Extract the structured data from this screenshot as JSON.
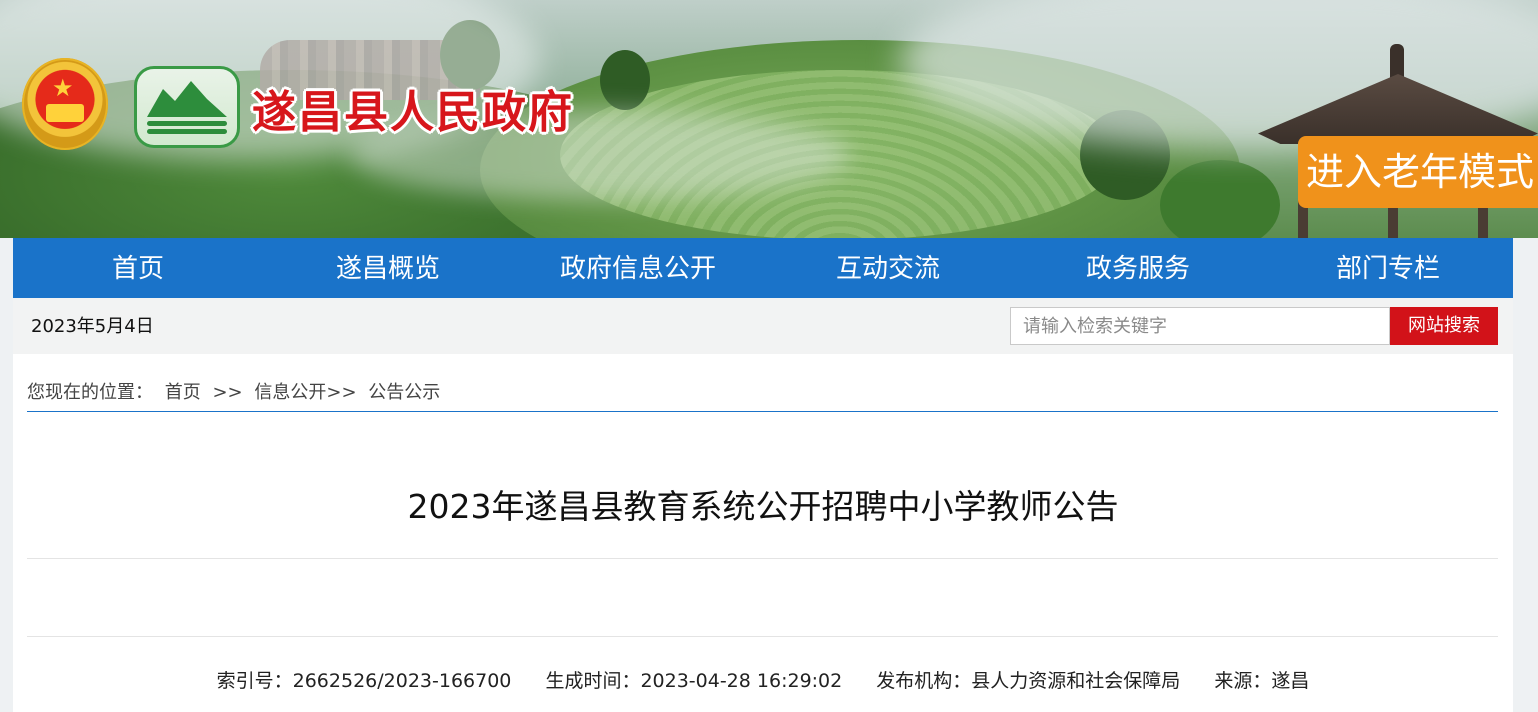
{
  "header": {
    "site_title": "遂昌县人民政府",
    "elder_mode_label": "进入老年模式"
  },
  "nav": {
    "items": [
      {
        "label": "首页"
      },
      {
        "label": "遂昌概览"
      },
      {
        "label": "政府信息公开"
      },
      {
        "label": "互动交流"
      },
      {
        "label": "政务服务"
      },
      {
        "label": "部门专栏"
      }
    ]
  },
  "toolbar": {
    "date": "2023年5月4日",
    "search_placeholder": "请输入检索关键字",
    "search_button": "网站搜索"
  },
  "breadcrumb": {
    "prefix": "您现在的位置：",
    "items": [
      "首页",
      "信息公开",
      "公告公示"
    ],
    "sep1": ">>",
    "sep2": ">>"
  },
  "article": {
    "title": "2023年遂昌县教育系统公开招聘中小学教师公告",
    "meta": {
      "index": "索引号：2662526/2023-166700",
      "generated": "生成时间：2023-04-28 16:29:02",
      "publisher": "发布机构：县人力资源和社会保障局",
      "source": "来源：遂昌"
    }
  },
  "colors": {
    "nav_bg": "#1a73c9",
    "search_button_bg": "#d21219",
    "elder_button_bg": "#f0921b",
    "title_red": "#d7161b"
  }
}
